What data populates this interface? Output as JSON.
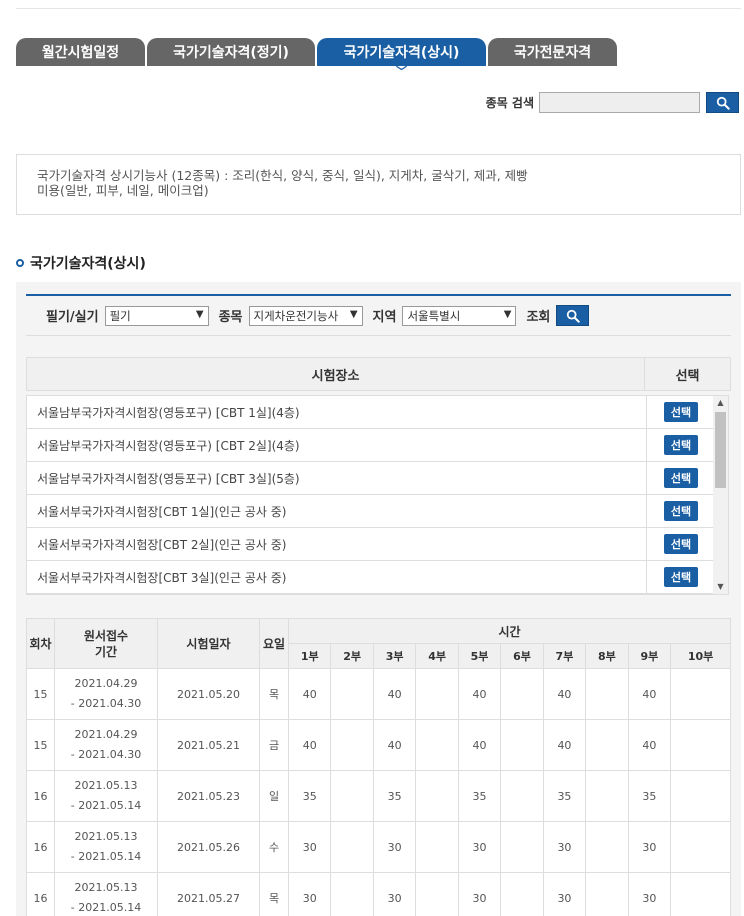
{
  "tabs": [
    {
      "label": "월간시험일정",
      "active": false
    },
    {
      "label": "국가기술자격(정기)",
      "active": false
    },
    {
      "label": "국가기술자격(상시)",
      "active": true
    },
    {
      "label": "국가전문자격",
      "active": false
    }
  ],
  "search": {
    "label": "종목 검색",
    "value": "",
    "icon": "search-icon"
  },
  "info": {
    "line1": "국가기술자격 상시기능사 (12종목) : 조리(한식, 양식, 중식, 일식), 지게차, 굴삭기, 제과, 제빵",
    "line2": "미용(일반, 피부, 네일, 메이크업)"
  },
  "section_title": "국가기술자격(상시)",
  "filters": {
    "type_label": "필기/실기",
    "type_value": "필기",
    "item_label": "종목",
    "item_value": "지게차운전기능사",
    "region_label": "지역",
    "region_value": "서울특별시",
    "query_label": "조회"
  },
  "site_table": {
    "header_site": "시험장소",
    "header_select": "선택",
    "button_label": "선택",
    "rows": [
      "서울남부국가자격시험장(영등포구) [CBT 1실](4층)",
      "서울남부국가자격시험장(영등포구) [CBT 2실](4층)",
      "서울남부국가자격시험장(영등포구) [CBT 3실](5층)",
      "서울서부국가자격시험장[CBT 1실](인근 공사 중)",
      "서울서부국가자격시험장[CBT 2실](인근 공사 중)",
      "서울서부국가자격시험장[CBT 3실](인근 공사 중)"
    ]
  },
  "schedule": {
    "headers": {
      "round": "회차",
      "period": "원서접수\n기간",
      "date": "시험일자",
      "day": "요일",
      "time": "시간"
    },
    "slots": [
      "1부",
      "2부",
      "3부",
      "4부",
      "5부",
      "6부",
      "7부",
      "8부",
      "9부",
      "10부"
    ],
    "rows": [
      {
        "round": "15",
        "from": "2021.04.29",
        "to": "- 2021.04.30",
        "date": "2021.05.20",
        "day": "목",
        "slots": [
          "40",
          "",
          "40",
          "",
          "40",
          "",
          "40",
          "",
          "40",
          ""
        ]
      },
      {
        "round": "15",
        "from": "2021.04.29",
        "to": "- 2021.04.30",
        "date": "2021.05.21",
        "day": "금",
        "slots": [
          "40",
          "",
          "40",
          "",
          "40",
          "",
          "40",
          "",
          "40",
          ""
        ]
      },
      {
        "round": "16",
        "from": "2021.05.13",
        "to": "- 2021.05.14",
        "date": "2021.05.23",
        "day": "일",
        "slots": [
          "35",
          "",
          "35",
          "",
          "35",
          "",
          "35",
          "",
          "35",
          ""
        ]
      },
      {
        "round": "16",
        "from": "2021.05.13",
        "to": "- 2021.05.14",
        "date": "2021.05.26",
        "day": "수",
        "slots": [
          "30",
          "",
          "30",
          "",
          "30",
          "",
          "30",
          "",
          "30",
          ""
        ]
      },
      {
        "round": "16",
        "from": "2021.05.13",
        "to": "- 2021.05.14",
        "date": "2021.05.27",
        "day": "목",
        "slots": [
          "30",
          "",
          "30",
          "",
          "30",
          "",
          "30",
          "",
          "30",
          ""
        ]
      }
    ]
  },
  "colors": {
    "accent": "#1a5fa3",
    "tab_inactive": "#666666"
  }
}
